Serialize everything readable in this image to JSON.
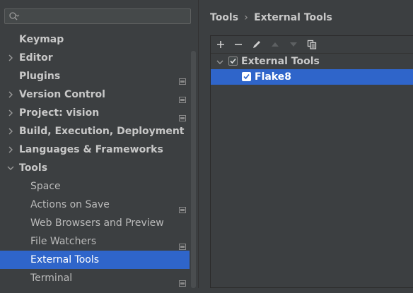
{
  "sidebar": {
    "search": {
      "placeholder": "",
      "value": ""
    },
    "items": [
      {
        "label": "Keymap",
        "expandable": false,
        "project_icon": false
      },
      {
        "label": "Editor",
        "expandable": true,
        "project_icon": false
      },
      {
        "label": "Plugins",
        "expandable": false,
        "project_icon": true
      },
      {
        "label": "Version Control",
        "expandable": true,
        "project_icon": true
      },
      {
        "label": "Project: vision",
        "expandable": true,
        "project_icon": true
      },
      {
        "label": "Build, Execution, Deployment",
        "expandable": true,
        "project_icon": false
      },
      {
        "label": "Languages & Frameworks",
        "expandable": true,
        "project_icon": false
      },
      {
        "label": "Tools",
        "expandable": true,
        "expanded": true,
        "project_icon": false,
        "children": [
          {
            "label": "Space",
            "project_icon": false
          },
          {
            "label": "Actions on Save",
            "project_icon": true
          },
          {
            "label": "Web Browsers and Preview",
            "project_icon": false
          },
          {
            "label": "File Watchers",
            "project_icon": true
          },
          {
            "label": "External Tools",
            "project_icon": false,
            "selected": true
          },
          {
            "label": "Terminal",
            "project_icon": true
          }
        ]
      }
    ]
  },
  "breadcrumb": {
    "parent": "Tools",
    "current": "External Tools"
  },
  "toolbar": {
    "buttons": [
      "add-icon",
      "remove-icon",
      "edit-icon",
      "move-up-icon",
      "move-down-icon",
      "copy-icon"
    ]
  },
  "tools_tree": {
    "group": {
      "label": "External Tools",
      "checked": true,
      "expanded": true
    },
    "items": [
      {
        "label": "Flake8",
        "checked": true,
        "selected": true
      }
    ]
  },
  "colors": {
    "background": "#3c3f41",
    "selection": "#2f65ca",
    "text": "#bbbbbb"
  }
}
